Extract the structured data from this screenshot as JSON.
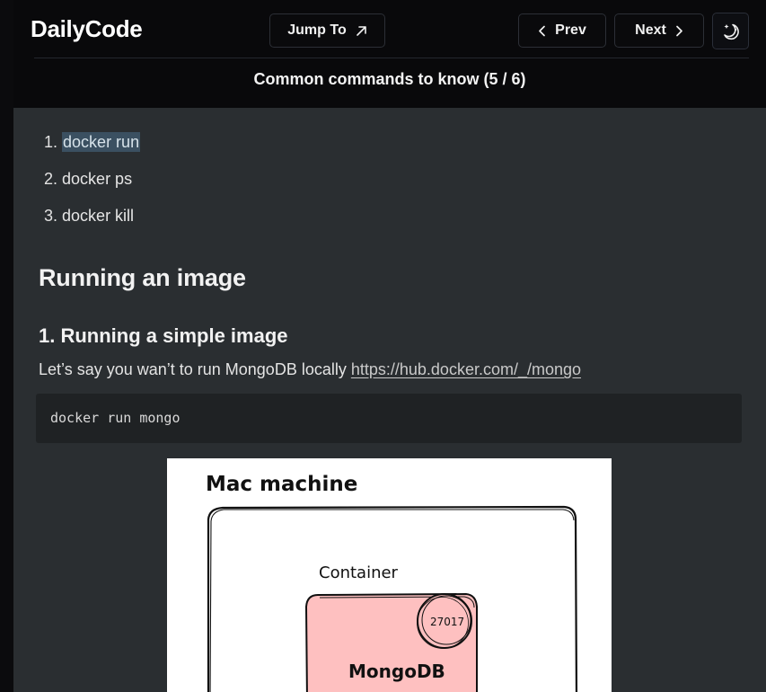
{
  "header": {
    "logo": "DailyCode",
    "jump_label": "Jump To",
    "prev_label": "Prev",
    "next_label": "Next",
    "subtitle": "Common commands to know (5 / 6)"
  },
  "content": {
    "commands": [
      {
        "num": "1.",
        "text": "docker run",
        "highlighted": true
      },
      {
        "num": "2.",
        "text": "docker ps",
        "highlighted": false
      },
      {
        "num": "3.",
        "text": "docker kill",
        "highlighted": false
      }
    ],
    "heading": "Running an image",
    "subheading": "1. Running a simple image",
    "paragraph_text": "Let’s say you wan’t to run MongoDB locally ",
    "link_text": "https://hub.docker.com/_/mongo",
    "code": "docker run mongo"
  },
  "diagram": {
    "machine_label": "Mac machine",
    "container_label": "Container",
    "port_label": "27017",
    "db_label": "MongoDB"
  },
  "colors": {
    "background": "#2a2e31",
    "topbar": "#09090b",
    "highlight": "#3b5061",
    "container_fill": "#fec0c0"
  },
  "icons": {
    "jump": "arrow-up-right-icon",
    "prev": "chevron-left-icon",
    "next": "chevron-right-icon",
    "theme": "moon-stars-icon"
  }
}
